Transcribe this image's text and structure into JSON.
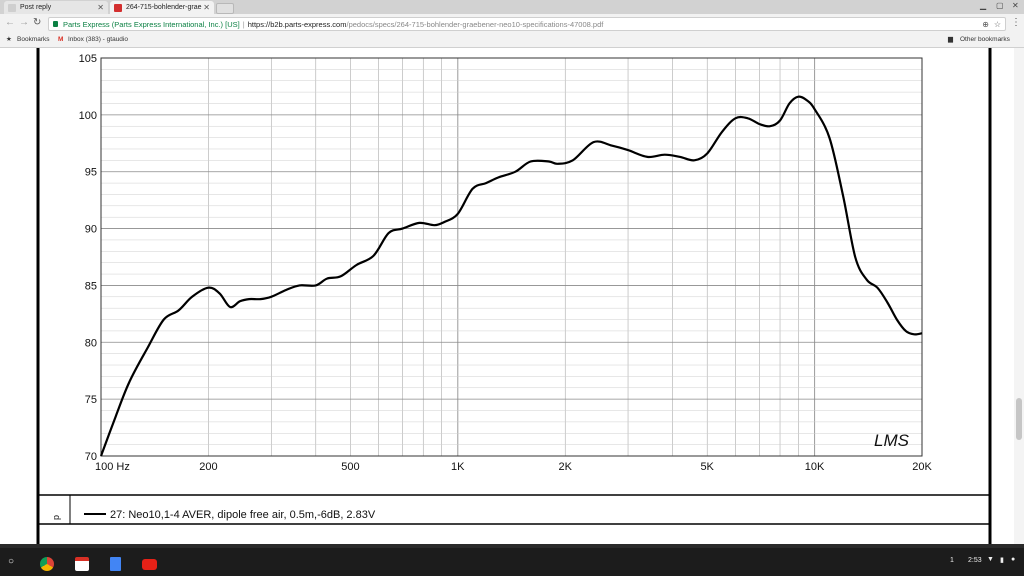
{
  "tabs": [
    {
      "title": "Post reply"
    },
    {
      "title": "264-715-bohlender-grae"
    }
  ],
  "omnibox": {
    "secure_label": "Parts Express (Parts Express International, Inc.) [US]",
    "url_scheme_host": "https://b2b.parts-express.com",
    "url_path": "/pedocs/specs/264-715-bohlender-graebener-neo10-specifications-47008.pdf"
  },
  "bookmarks": {
    "bar_label": "Bookmarks",
    "inbox_label": "Inbox (383) - gtaudio",
    "other_label": "Other bookmarks"
  },
  "chart_data": {
    "type": "line",
    "scale": "log-x",
    "xlim": [
      100,
      20000
    ],
    "ylim": [
      70,
      105
    ],
    "grid": true,
    "y_ticks": [
      "105",
      "100",
      "95",
      "90",
      "85",
      "80",
      "75",
      "70"
    ],
    "x_ticks": [
      "100 Hz",
      "200",
      "500",
      "1K",
      "2K",
      "5K",
      "10K",
      "20K"
    ],
    "annotation": "LMS",
    "legend_text": "27: Neo10,1-4 AVER, dipole free air, 0.5m,-6dB, 2.83V",
    "legend_placement": "bottom-left",
    "series": [
      {
        "x": [
          100,
          110,
          120,
          135,
          150,
          165,
          180,
          200,
          215,
          230,
          245,
          260,
          280,
          300,
          330,
          360,
          400,
          430,
          470,
          520,
          580,
          640,
          700,
          780,
          860,
          920,
          1000,
          1100,
          1200,
          1300,
          1450,
          1600,
          1800,
          1900,
          2100,
          2400,
          2700,
          3000,
          3400,
          3800,
          4200,
          4600,
          5000,
          5500,
          6000,
          6500,
          7000,
          7500,
          8000,
          8500,
          9000,
          9500,
          10000,
          11000,
          12000,
          13000,
          14000,
          15000,
          16000,
          17000,
          18000,
          19000,
          20000
        ],
        "y": [
          70.0,
          73.5,
          76.5,
          79.5,
          82.0,
          82.8,
          84.0,
          84.8,
          84.3,
          83.1,
          83.6,
          83.8,
          83.8,
          84.0,
          84.6,
          85.0,
          85.0,
          85.6,
          85.8,
          86.8,
          87.6,
          89.6,
          90.0,
          90.5,
          90.3,
          90.6,
          91.3,
          93.5,
          94.0,
          94.5,
          95.0,
          95.9,
          95.9,
          95.7,
          96.0,
          97.6,
          97.3,
          96.9,
          96.3,
          96.5,
          96.3,
          96.0,
          96.6,
          98.5,
          99.7,
          99.7,
          99.2,
          99.0,
          99.5,
          101.0,
          101.6,
          101.3,
          100.5,
          98.0,
          93.0,
          87.5,
          85.5,
          84.8,
          83.5,
          82.0,
          81.0,
          80.7,
          80.8
        ]
      }
    ]
  },
  "shelf": {
    "notification_count": "1",
    "time": "2:53"
  }
}
